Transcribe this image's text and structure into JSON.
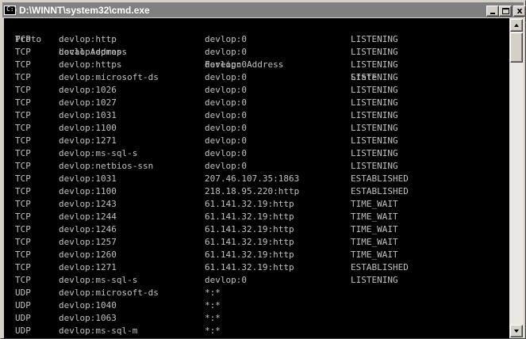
{
  "window": {
    "title": "D:\\WINNT\\system32\\cmd.exe",
    "icon": "cmd-icon",
    "title_bar_color": "#808080",
    "buttons": {
      "minimize": "_",
      "maximize": "□",
      "close": "x"
    }
  },
  "console": {
    "background": "#000000",
    "text_color": "#c0c0c0",
    "header": [
      "Proto",
      "Local Address",
      "Foreign Address",
      "State"
    ],
    "rows": [
      [
        "TCP",
        "devlop:http",
        "devlop:0",
        "LISTENING"
      ],
      [
        "TCP",
        "devlop:epmap",
        "devlop:0",
        "LISTENING"
      ],
      [
        "TCP",
        "devlop:https",
        "devlop:0",
        "LISTENING"
      ],
      [
        "TCP",
        "devlop:microsoft-ds",
        "devlop:0",
        "LISTENING"
      ],
      [
        "TCP",
        "devlop:1026",
        "devlop:0",
        "LISTENING"
      ],
      [
        "TCP",
        "devlop:1027",
        "devlop:0",
        "LISTENING"
      ],
      [
        "TCP",
        "devlop:1031",
        "devlop:0",
        "LISTENING"
      ],
      [
        "TCP",
        "devlop:1100",
        "devlop:0",
        "LISTENING"
      ],
      [
        "TCP",
        "devlop:1271",
        "devlop:0",
        "LISTENING"
      ],
      [
        "TCP",
        "devlop:ms-sql-s",
        "devlop:0",
        "LISTENING"
      ],
      [
        "TCP",
        "devlop:netbios-ssn",
        "devlop:0",
        "LISTENING"
      ],
      [
        "TCP",
        "devlop:1031",
        "207.46.107.35:1863",
        "ESTABLISHED"
      ],
      [
        "TCP",
        "devlop:1100",
        "218.18.95.220:http",
        "ESTABLISHED"
      ],
      [
        "TCP",
        "devlop:1243",
        "61.141.32.19:http",
        "TIME_WAIT"
      ],
      [
        "TCP",
        "devlop:1244",
        "61.141.32.19:http",
        "TIME_WAIT"
      ],
      [
        "TCP",
        "devlop:1246",
        "61.141.32.19:http",
        "TIME_WAIT"
      ],
      [
        "TCP",
        "devlop:1257",
        "61.141.32.19:http",
        "TIME_WAIT"
      ],
      [
        "TCP",
        "devlop:1260",
        "61.141.32.19:http",
        "TIME_WAIT"
      ],
      [
        "TCP",
        "devlop:1271",
        "61.141.32.19:http",
        "ESTABLISHED"
      ],
      [
        "TCP",
        "devlop:ms-sql-s",
        "devlop:0",
        "LISTENING"
      ],
      [
        "UDP",
        "devlop:microsoft-ds",
        "*:*",
        ""
      ],
      [
        "UDP",
        "devlop:1040",
        "*:*",
        ""
      ],
      [
        "UDP",
        "devlop:1063",
        "*:*",
        ""
      ],
      [
        "UDP",
        "devlop:ms-sql-m",
        "*:*",
        ""
      ]
    ]
  }
}
